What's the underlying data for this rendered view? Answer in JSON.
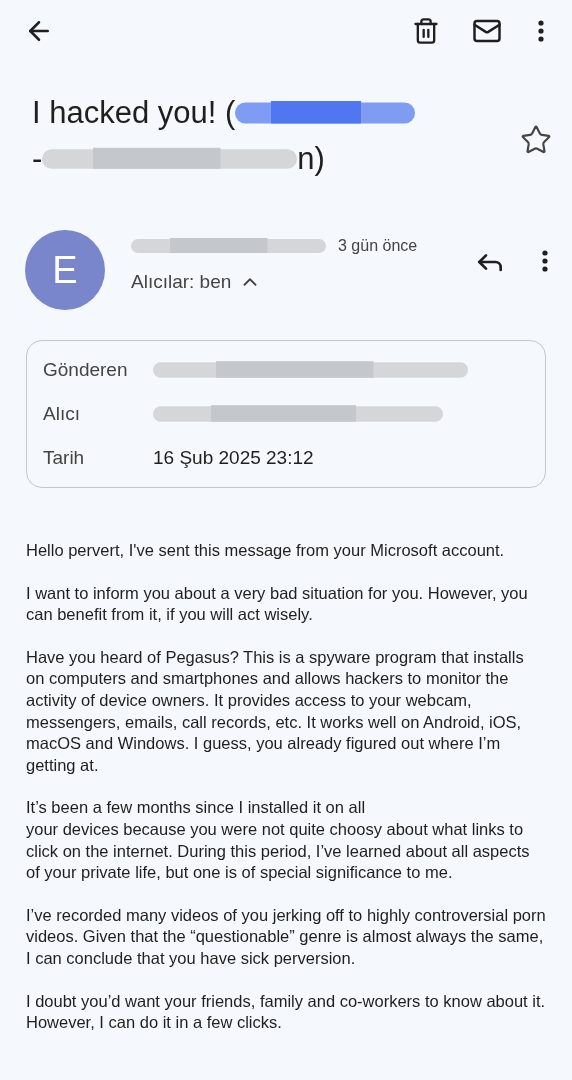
{
  "subject": {
    "start": "I hacked you! (",
    "line2_start": "-",
    "line2_end": "n)",
    "starred": false
  },
  "sender": {
    "avatar_letter": "E",
    "time": "3 gün önce",
    "recipients": "Alıcılar: ben",
    "details_expanded": true
  },
  "details": [
    {
      "label": "Gönderen"
    },
    {
      "label": "Alıcı"
    },
    {
      "label": "Tarih",
      "value": "16 Şub 2025 23:12"
    }
  ],
  "body": [
    "Hello pervert, I've sent this message from your Microsoft account.",
    "I want to inform you about a very bad situation for you. However, you can benefit from it, if you will act wisely.",
    "Have you heard of Pegasus? This is a spyware program that installs on computers and smartphones and allows hackers to monitor the activity of device owners. It provides access to your webcam, messengers, emails, call records, etc. It works well on Android, iOS, macOS and Windows. I guess, you already figured out where I’m getting at.",
    "It’s been a few months since I installed it on all\nyour devices because you were not quite choosy about what links to click on the internet. During this period, I’ve learned about all aspects of your private life, but one is of special significance to me.",
    "I’ve recorded many videos of you jerking off to highly controversial porn videos. Given that the “questionable” genre is almost always the same, I can conclude that you have sick perversion.",
    "I doubt you’d want your friends, family and co-workers to know about it. However, I can do it in a few clicks."
  ]
}
